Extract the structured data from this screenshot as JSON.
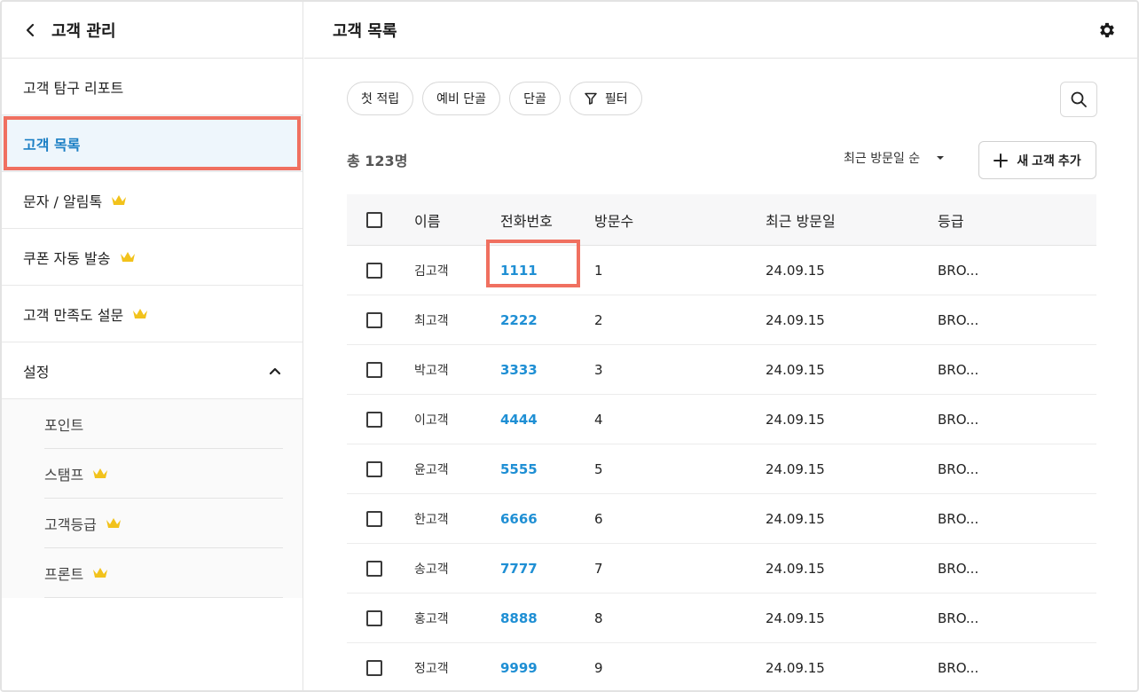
{
  "sidebar": {
    "title": "고객 관리",
    "items": [
      {
        "label": "고객 탐구 리포트",
        "premium": false
      },
      {
        "label": "고객 목록",
        "premium": false,
        "active": true
      },
      {
        "label": "문자 / 알림톡",
        "premium": true
      },
      {
        "label": "쿠폰 자동 발송",
        "premium": true
      },
      {
        "label": "고객 만족도 설문",
        "premium": true
      }
    ],
    "settings": {
      "label": "설정",
      "expanded": true,
      "subitems": [
        {
          "label": "포인트",
          "premium": false
        },
        {
          "label": "스탬프",
          "premium": true
        },
        {
          "label": "고객등급",
          "premium": true
        },
        {
          "label": "프론트",
          "premium": true
        }
      ]
    }
  },
  "main": {
    "title": "고객 목록",
    "chips": [
      {
        "label": "첫 적립"
      },
      {
        "label": "예비 단골"
      },
      {
        "label": "단골"
      },
      {
        "label": "필터",
        "icon": "filter-icon"
      }
    ],
    "count": "총 123명",
    "sort_label": "최근 방문일 순",
    "add_label": "새 고객 추가",
    "table": {
      "headers": {
        "name": "이름",
        "phone": "전화번호",
        "visits": "방문수",
        "recent": "최근 방문일",
        "grade": "등급"
      },
      "rows": [
        {
          "name": "김고객",
          "phone": "1111",
          "visits": "1",
          "recent": "24.09.15",
          "grade": "BRO..."
        },
        {
          "name": "최고객",
          "phone": "2222",
          "visits": "2",
          "recent": "24.09.15",
          "grade": "BRO..."
        },
        {
          "name": "박고객",
          "phone": "3333",
          "visits": "3",
          "recent": "24.09.15",
          "grade": "BRO..."
        },
        {
          "name": "이고객",
          "phone": "4444",
          "visits": "4",
          "recent": "24.09.15",
          "grade": "BRO..."
        },
        {
          "name": "윤고객",
          "phone": "5555",
          "visits": "5",
          "recent": "24.09.15",
          "grade": "BRO..."
        },
        {
          "name": "한고객",
          "phone": "6666",
          "visits": "6",
          "recent": "24.09.15",
          "grade": "BRO..."
        },
        {
          "name": "송고객",
          "phone": "7777",
          "visits": "7",
          "recent": "24.09.15",
          "grade": "BRO..."
        },
        {
          "name": "홍고객",
          "phone": "8888",
          "visits": "8",
          "recent": "24.09.15",
          "grade": "BRO..."
        },
        {
          "name": "정고객",
          "phone": "9999",
          "visits": "9",
          "recent": "24.09.15",
          "grade": "BRO..."
        }
      ]
    }
  },
  "colors": {
    "accent": "#1f8fd4",
    "active_bg": "#eef6fc",
    "highlight": "#f07060",
    "crown": "#f2c21b"
  }
}
